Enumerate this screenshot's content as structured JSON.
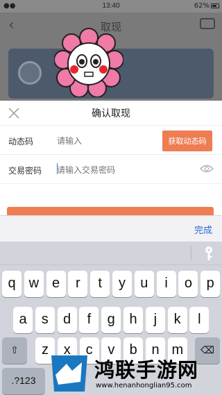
{
  "status_bar": {
    "signal": "●● ",
    "time": "13:40",
    "battery": "62%"
  },
  "background_page": {
    "title": "取现"
  },
  "dialog": {
    "title": "确认取现",
    "rows": [
      {
        "label": "动态码",
        "placeholder": "请输入",
        "button": "获取动态码"
      },
      {
        "label": "交易密码",
        "placeholder": "请输入交易密码"
      }
    ]
  },
  "accessory": {
    "done_label": "完成"
  },
  "keyboard": {
    "row1": [
      "q",
      "w",
      "e",
      "r",
      "t",
      "y",
      "u",
      "i",
      "o",
      "p"
    ],
    "row2": [
      "a",
      "s",
      "d",
      "f",
      "g",
      "h",
      "j",
      "k",
      "l"
    ],
    "row3": [
      "z",
      "x",
      "c",
      "v",
      "b",
      "n",
      "m"
    ],
    "numbers_label": ".?123"
  },
  "watermark": {
    "title": "鸿联手游网",
    "url": "www.henanhonglian95.com"
  },
  "colors": {
    "accent": "#ee7d54",
    "link": "#2b6ad8"
  }
}
